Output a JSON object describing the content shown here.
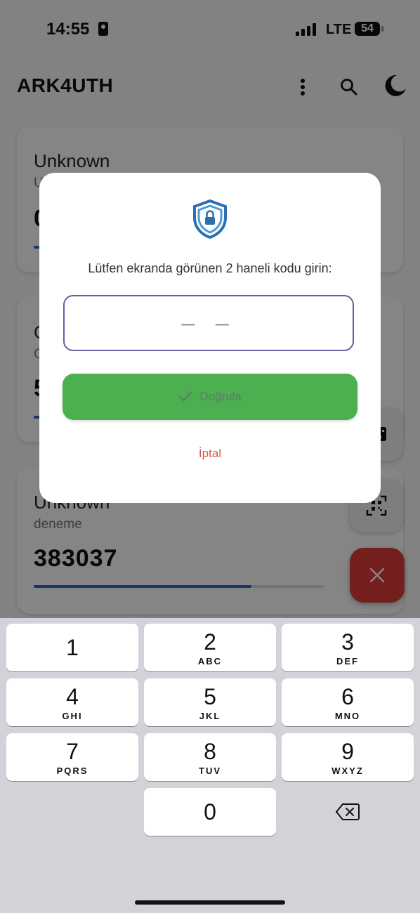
{
  "status_bar": {
    "time": "14:55",
    "network": "LTE",
    "battery": "54"
  },
  "app_bar": {
    "title": "ARK4UTH",
    "icons": [
      "more-vert-icon",
      "search-icon",
      "dark-mode-moon-icon"
    ]
  },
  "cards": [
    {
      "issuer": "Unknown",
      "account": "U",
      "code": "0",
      "progress": 0.75
    },
    {
      "issuer": "G",
      "account": "G",
      "code": "5",
      "progress": 0.75
    },
    {
      "issuer": "Unknown",
      "account": "deneme",
      "code": "383037",
      "progress": 0.75
    }
  ],
  "dialog": {
    "icon": "shield-lock-icon",
    "prompt": "Lütfen ekranda görünen 2 haneli kodu girin:",
    "input_placeholder": "– –",
    "verify_label": "Doğrula",
    "cancel_label": "İptal"
  },
  "fabs": {
    "icons": [
      "keyboard-icon",
      "qr-scan-icon",
      "close-icon"
    ]
  },
  "keyboard": {
    "keys": [
      {
        "digit": "1",
        "letters": ""
      },
      {
        "digit": "2",
        "letters": "ABC"
      },
      {
        "digit": "3",
        "letters": "DEF"
      },
      {
        "digit": "4",
        "letters": "GHI"
      },
      {
        "digit": "5",
        "letters": "JKL"
      },
      {
        "digit": "6",
        "letters": "MNO"
      },
      {
        "digit": "7",
        "letters": "PQRS"
      },
      {
        "digit": "8",
        "letters": "TUV"
      },
      {
        "digit": "9",
        "letters": "WXYZ"
      },
      {
        "digit": "0",
        "letters": ""
      }
    ],
    "backspace_icon": "backspace-icon"
  },
  "colors": {
    "accent": "#6f5a9d",
    "verify": "#4caf50",
    "cancel": "#d9534f",
    "fab": "#e13b3b",
    "progress": "#2f66c8"
  }
}
